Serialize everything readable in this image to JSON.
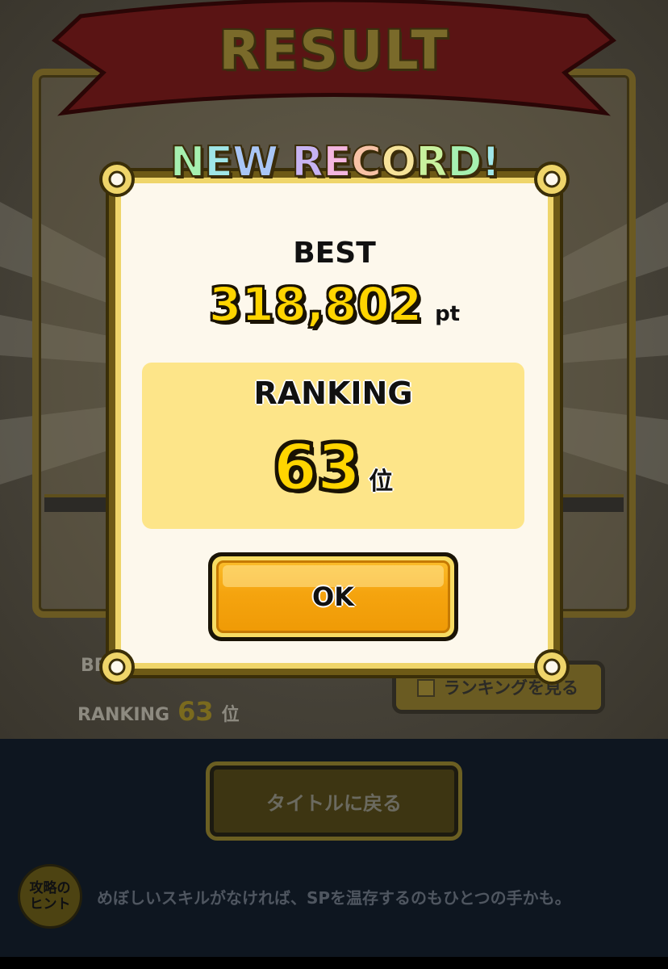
{
  "background": {
    "banner_title": "RESULT",
    "best_label": "BEST",
    "ranking_label": "RANKING",
    "ranking_value": "63",
    "ranking_unit": "位",
    "ranking_button_label": "ランキングを見る"
  },
  "popup": {
    "header": "NEW RECORD!",
    "best_label": "BEST",
    "best_value": "318,802",
    "best_unit": "pt",
    "ranking_label": "RANKING",
    "ranking_value": "63",
    "ranking_unit": "位",
    "ok_label": "OK"
  },
  "footer": {
    "title_button_label": "タイトルに戻る",
    "hint_badge_line1": "攻略の",
    "hint_badge_line2": "ヒント",
    "hint_text": "めぼしいスキルがなければ、SPを温存するのもひとつの手かも。"
  },
  "colors": {
    "gold": "#ffd500",
    "button_orange": "#f5a40f",
    "rank_box": "#fde589",
    "card": "#fdf8ec",
    "bottom_panel": "#0e1620"
  }
}
